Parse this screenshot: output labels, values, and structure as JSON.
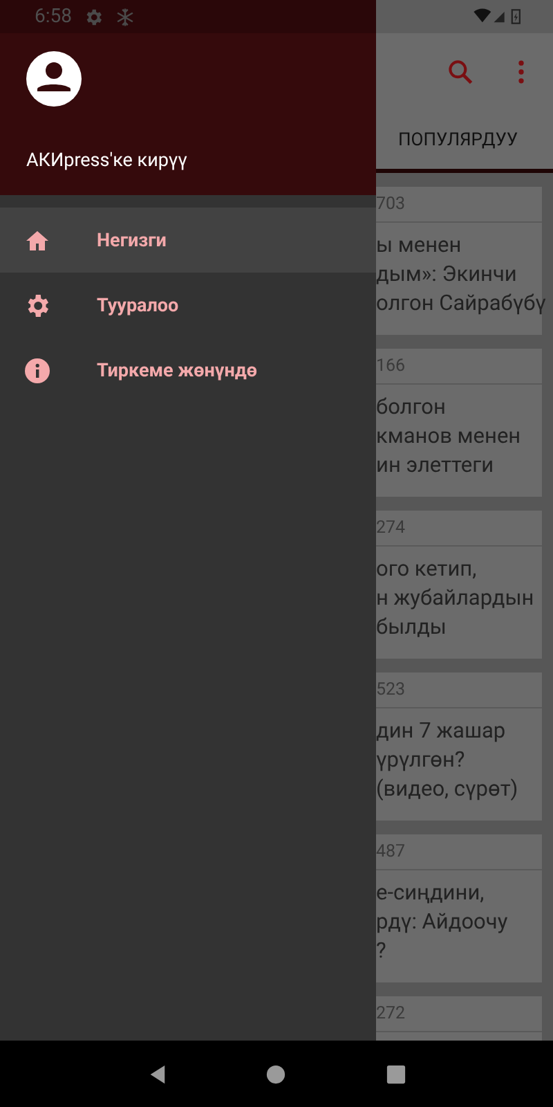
{
  "status_bar": {
    "time": "6:58"
  },
  "drawer": {
    "account_label": "АКИpress'ке кирүү",
    "items": [
      {
        "label": "Негизги",
        "kind": "home",
        "selected": true
      },
      {
        "label": "Тууралоо",
        "kind": "settings",
        "selected": false
      },
      {
        "label": "Тиркеме жөнүндө",
        "kind": "info",
        "selected": false
      }
    ]
  },
  "app": {
    "tabs": [
      {
        "label": "ПОПУЛЯРДУУ",
        "selected": true
      }
    ],
    "articles": [
      {
        "views": "703",
        "lines": [
          "ы менен",
          "дым»: Экинчи",
          "олгон Сайрабүбү"
        ]
      },
      {
        "views": "166",
        "lines": [
          "болгон",
          "кманов менен",
          "ин элеттеги"
        ]
      },
      {
        "views": "274",
        "lines": [
          "ого кетип,",
          "н жубайлардын",
          "былды"
        ]
      },
      {
        "views": "523",
        "lines": [
          "дин 7 жашар",
          "үрүлгөн?",
          "(видео, сүрөт)"
        ]
      },
      {
        "views": "487",
        "lines": [
          "е-сиңдини,",
          "рдү: Айдоочу",
          "?"
        ]
      },
      {
        "views": "272"
      }
    ]
  }
}
